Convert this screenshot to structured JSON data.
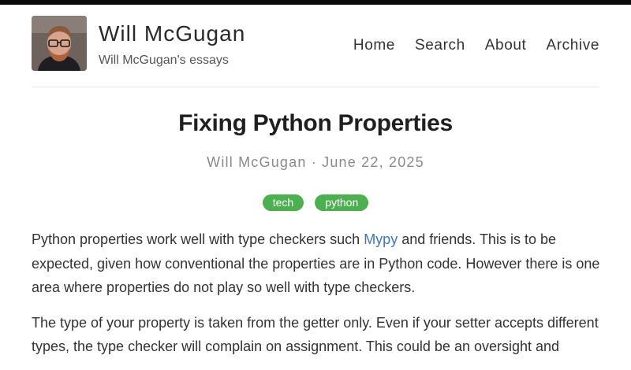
{
  "header": {
    "title": "Will McGugan",
    "subtitle": "Will McGugan's essays",
    "nav": [
      {
        "label": "Home"
      },
      {
        "label": "Search"
      },
      {
        "label": "About"
      },
      {
        "label": "Archive"
      }
    ]
  },
  "post": {
    "title": "Fixing Python Properties",
    "byline": "Will McGugan · June 22, 2025",
    "tags": [
      "tech",
      "python"
    ],
    "p1_before": "Python properties work well with type checkers such ",
    "p1_link": "Mypy",
    "p1_after": " and friends. This is to be expected, given how conventional the properties are in Python code. However there is one area where properties do not play so well with type checkers.",
    "p2": "The type of your property is taken from the getter only. Even if your setter accepts different types, the type checker will complain on assignment. This could be an oversight and"
  },
  "colors": {
    "topbar": "#0b0b0b",
    "tag_bg": "#4caf50",
    "link": "#3a78b8"
  }
}
